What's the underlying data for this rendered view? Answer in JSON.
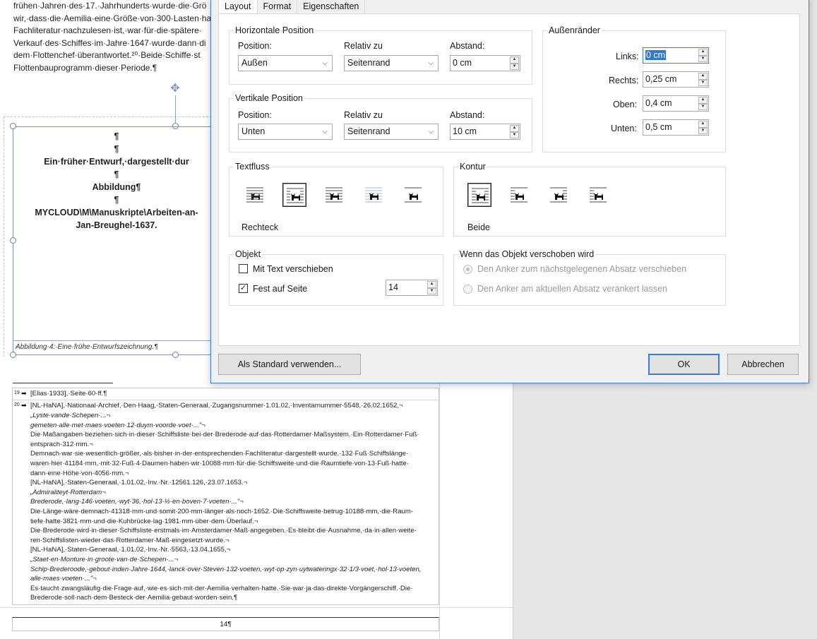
{
  "document": {
    "body_lines": [
      "frühen·Jahren·des·17.·Jahrhunderts·wurde·die·Grö",
      "wir,·dass·die·Aemilia·eine·Größe·von·300·Lasten·ha",
      "Fachliteratur·nachzulesen·ist,·war·für·die·spätere·",
      "Verkauf·des·Schiffes·im·Jahre·1647·wurde·dann·di",
      "dem·Flottenchef·überantwortet.²⁰·Beide·Schiffe·st",
      "Flottenbauprogramm·dieser·Periode.¶"
    ],
    "frame_lines": [
      "¶",
      "¶",
      "Ein·früher·Entwurf,·dargestellt·dur",
      "¶",
      "Abbildung¶",
      "¶",
      "MYCLOUD\\M\\Manuskripte\\Arbeiten-an-",
      "Jan-Breughel-1637."
    ],
    "caption": "Abbildung·4:·Eine·frühe·Entwurfszeichnung.¶",
    "footnotes": [
      {
        "num": "19",
        "text": "[Elias·1933],·Seite·60·ff.¶"
      },
      {
        "num": "20",
        "text": "[NL-HaNA],·Nationaal·Archief,·Den·Haag,·Staten-Generaal,·Zugangsnummer·1.01.02,·Inventarnummer·5548,·26.02.1652,¬"
      }
    ],
    "footnote_lines": [
      {
        "text": "„Lyste·vande·Schepen·...¬",
        "italic": true
      },
      {
        "text": "gemeten·alle·met·maes·voeten·12·duym·voorde·voet·...\"¬",
        "italic": true
      },
      {
        "text": "Die·Maßangaben·beziehen·sich·in·dieser·Schiffsliste·bei·der·Brederode·auf·das·Rotterdamer·Maßsystem.·Ein·Rotterdamer·Fuß·",
        "italic": false
      },
      {
        "text": "entsprach·312·mm.¬",
        "italic": false
      },
      {
        "text": "Demnach·war·sie·wesentlich·größer,·als·bisher·in·der·entsprechenden·Fachliteratur·dargestellt·wurde.·132·Fuß·Schiffslänge·",
        "italic": false
      },
      {
        "text": "waren·hier·41184·mm,·mit·32·Fuß·4·Daumen·haben·wir·10088·mm·für·die·Schiffsweite·und·die·Raumtiefe·von·13·Fuß·hatte·",
        "italic": false
      },
      {
        "text": "dann·eine·Höhe·von·4056·mm.¬",
        "italic": false
      },
      {
        "text": "[NL-HaNA],·Staten-Generaal,·1.01.02,·Inv.·Nr.·12561.126,·23.07.1653.¬",
        "italic": false
      },
      {
        "text": "„Admiraliteyt·Rotterdam¬",
        "italic": true
      },
      {
        "text": "Brederode,·lang·146·voeten,·wyt·36,·hol·13·½·en·boven·7·voeten·...\"¬",
        "italic": true
      },
      {
        "text": "Die·Länge·wäre·demnach·41318·mm·und·somit·200·mm·länger·als·noch·1652.·Die·Schiffsweite·betrug·10188·mm,·die·Raum-",
        "italic": false
      },
      {
        "text": "tiefe·hatte·3821·mm·und·die·Kuhbrücke·lag·1981·mm·über·dem·Überlauf.¬",
        "italic": false
      },
      {
        "text": "Die·Brederode·wird·in·dieser·Schiffsliste·erstmals·im·Amsterdamer·Maß·angegeben.·Es·bleibt·die·Ausnahme,·da·in·allen·weite-",
        "italic": false
      },
      {
        "text": "ren·Schiffslisten·wieder·das·Rotterdamer·Maß·eingesetzt·wurde.¬",
        "italic": false
      },
      {
        "text": "[NL-HaNA],·Staten-Generaal,·1.01.02,·Inv.·Nr.·5563,·13.04.1655,¬",
        "italic": false
      },
      {
        "text": "„Staet·en·Monture·in·groote·van·de·Schepen·...¬",
        "italic": true
      },
      {
        "text": "Schip·Brederoode,·gebout·inden·Jahre·1644,·lanck·over·Steven·132·voeten,·wyt·op·zyn·uytwateringx·32·1/3·voet,·hol·13·voeten,",
        "italic": true
      },
      {
        "text": "alle·maes·voeten·...\"¬",
        "italic": true
      },
      {
        "text": "Es·taucht·zwangsläufig·die·Frage·auf,·wie·es·sich·mit·der·Aemilia·verhalten·hatte.·Sie·war·ja·das·direkte·Vorgängerschiff.·Die·",
        "italic": false
      },
      {
        "text": "Brederode·soll·nach·dem·Besteck·der·Aemilia·gebaut·worden·sein.¶",
        "italic": false
      }
    ],
    "page_number": "14¶"
  },
  "dialog": {
    "tabs": [
      {
        "label": "Layout",
        "active": true
      },
      {
        "label": "Format",
        "active": false
      },
      {
        "label": "Eigenschaften",
        "active": false
      }
    ],
    "horizontal": {
      "legend": "Horizontale Position",
      "position_label": "Position:",
      "position_value": "Außen",
      "relative_label": "Relativ zu",
      "relative_value": "Seitenrand",
      "distance_label": "Abstand:",
      "distance_value": "0 cm"
    },
    "vertical": {
      "legend": "Vertikale Position",
      "position_label": "Position:",
      "position_value": "Unten",
      "relative_label": "Relativ zu",
      "relative_value": "Seitenrand",
      "distance_label": "Abstand:",
      "distance_value": "10 cm"
    },
    "margins": {
      "legend": "Außenränder",
      "left_label": "Links:",
      "left_value": "0 cm",
      "right_label": "Rechts:",
      "right_value": "0,25 cm",
      "top_label": "Oben:",
      "top_value": "0,4 cm",
      "bottom_label": "Unten:",
      "bottom_value": "0,5 cm"
    },
    "textflow": {
      "legend": "Textfluss",
      "selected_label": "Rechteck",
      "selected_index": 1,
      "icons": [
        "wrap-none-icon",
        "wrap-rectangle-icon",
        "wrap-tight-icon",
        "wrap-through-icon",
        "wrap-top-bottom-icon"
      ]
    },
    "contour": {
      "legend": "Kontur",
      "selected_label": "Beide",
      "selected_index": 0,
      "icons": [
        "contour-both-icon",
        "contour-left-icon",
        "contour-right-icon",
        "contour-largest-icon"
      ]
    },
    "object": {
      "legend": "Objekt",
      "move_with_text_label": "Mit Text verschieben",
      "move_with_text_checked": false,
      "fix_on_page_label": "Fest auf Seite",
      "fix_on_page_checked": true,
      "page_value": "14"
    },
    "anchor": {
      "legend": "Wenn das Objekt verschoben wird",
      "option1_label": "Den Anker zum nächstgelegenen Absatz verschieben",
      "option2_label": "Den Anker am aktuellen Absatz verankert lassen"
    },
    "buttons": {
      "set_default": "Als Standard verwenden...",
      "ok": "OK",
      "cancel": "Abbrechen"
    }
  },
  "colors": {
    "accent": "#3b7fd4",
    "selection": "#2f78d4"
  }
}
